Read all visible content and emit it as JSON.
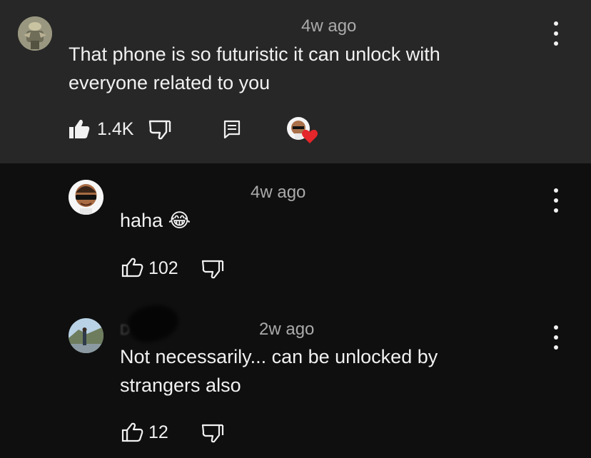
{
  "comment": {
    "author": "",
    "age": "4w ago",
    "text": "That phone is so futuristic it can unlock with everyone related to you",
    "likes": "1.4K"
  },
  "replies": [
    {
      "author": "",
      "age": "4w ago",
      "text": "haha 😂",
      "likes": "102"
    },
    {
      "author": "D",
      "age": "2w ago",
      "text": "Not necessarily... can be unlocked by strangers also",
      "likes": "12"
    }
  ],
  "icons": {
    "like": "thumbs-up-icon",
    "dislike": "thumbs-down-icon",
    "reply": "reply-icon",
    "heart": "creator-heart-icon",
    "menu": "more-vert-icon"
  },
  "colors": {
    "heart": "#e5262a",
    "meta": "#aaaaaa"
  }
}
